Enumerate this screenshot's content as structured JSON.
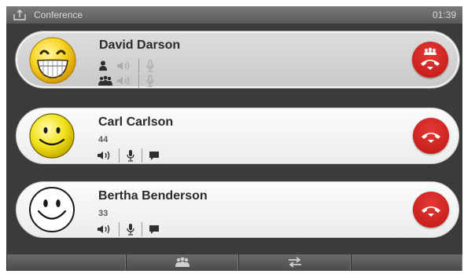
{
  "statusbar": {
    "title": "Conference",
    "time": "01:39",
    "icon": "share-icon"
  },
  "participants": [
    {
      "name": "David Darson",
      "number": "",
      "avatar": "grinning-smiley",
      "active": true,
      "rows": [
        [
          "person-icon",
          "speaker-icon",
          "microphone-icon"
        ],
        [
          "group-icon",
          "speaker-icon",
          "microphone-icon"
        ]
      ],
      "end_button_icon": "conference-hangup-icon"
    },
    {
      "name": "Carl Carlson",
      "number": "44",
      "avatar": "yellow-smiley",
      "active": false,
      "rows": [
        [
          "speaker-icon",
          "microphone-icon",
          "chat-icon"
        ]
      ],
      "end_button_icon": "hangup-icon"
    },
    {
      "name": "Bertha Benderson",
      "number": "33",
      "avatar": "outline-smiley",
      "active": false,
      "rows": [
        [
          "speaker-icon",
          "microphone-icon",
          "chat-icon"
        ]
      ],
      "end_button_icon": "hangup-icon"
    }
  ],
  "tabbar": {
    "items": [
      "group-icon",
      "transfer-icon"
    ]
  },
  "colors": {
    "end_call_red": "#d4221e",
    "status_bg": "#6a6a6a",
    "card_bg": "#f4f4f4"
  }
}
